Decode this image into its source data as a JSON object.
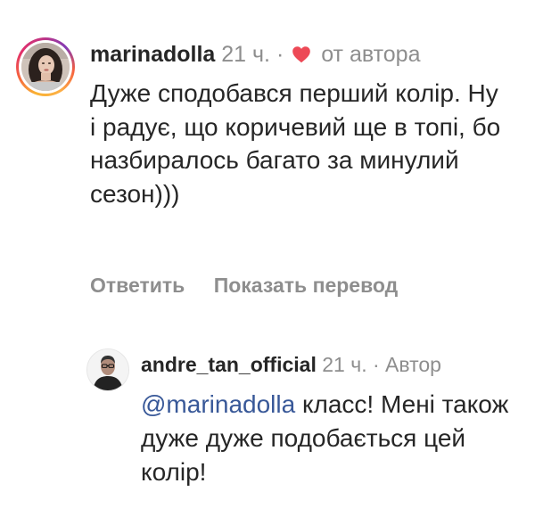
{
  "comments": [
    {
      "username": "marinadolla",
      "time": "21 ч.",
      "separator": "·",
      "liked_by_author_label": "от автора",
      "text": "Дуже сподобався перший колір. Ну і радує, що коричевий ще в топі, бо назбиралось багато за минулий сезон)))",
      "actions": {
        "reply": "Ответить",
        "translate": "Показать перевод"
      },
      "heart_icon": "heart-icon",
      "heart_color": "#ed4956"
    },
    {
      "username": "andre_tan_official",
      "time": "21 ч.",
      "separator": "·",
      "author_badge": "Автор",
      "mention": "@marinadolla",
      "text": " класс! Мені також дуже дуже подобається цей колір!",
      "mention_color": "#385898"
    }
  ]
}
